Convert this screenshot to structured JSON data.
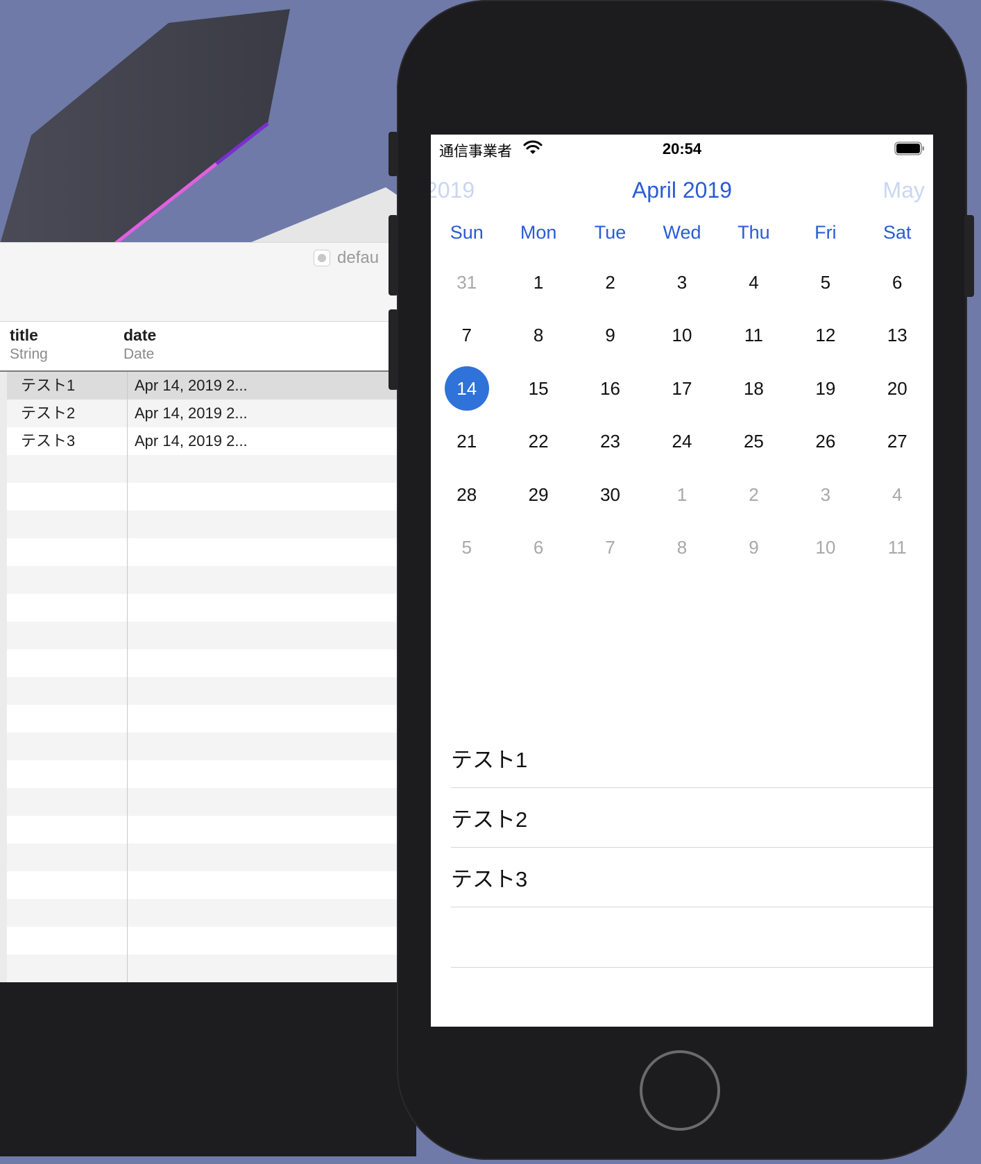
{
  "table": {
    "filter_label": "defau",
    "columns": [
      {
        "name": "title",
        "type": "String"
      },
      {
        "name": "date",
        "type": "Date"
      }
    ],
    "rows": [
      {
        "title": "テスト1",
        "date": "Apr 14, 2019 2..."
      },
      {
        "title": "テスト2",
        "date": "Apr 14, 2019 2..."
      },
      {
        "title": "テスト3",
        "date": "Apr 14, 2019 2..."
      }
    ]
  },
  "status_bar": {
    "carrier": "通信事業者",
    "time": "20:54"
  },
  "calendar": {
    "prev_month": "2019",
    "current_month": "April 2019",
    "next_month": "May",
    "weekdays": [
      "Sun",
      "Mon",
      "Tue",
      "Wed",
      "Thu",
      "Fri",
      "Sat"
    ],
    "days": [
      "31",
      "1",
      "2",
      "3",
      "4",
      "5",
      "6",
      "7",
      "8",
      "9",
      "10",
      "11",
      "12",
      "13",
      "14",
      "15",
      "16",
      "17",
      "18",
      "19",
      "20",
      "21",
      "22",
      "23",
      "24",
      "25",
      "26",
      "27",
      "28",
      "29",
      "30",
      "1",
      "2",
      "3",
      "4",
      "5",
      "6",
      "7",
      "8",
      "9",
      "10",
      "11"
    ],
    "selected_day": "14"
  },
  "events": [
    "テスト1",
    "テスト2",
    "テスト3"
  ],
  "colors": {
    "accent": "#2a5bd6",
    "selected_day_bg": "#2f72d9"
  },
  "icons": {
    "wifi": "wifi-icon",
    "battery": "battery-icon",
    "home": "home-button"
  }
}
